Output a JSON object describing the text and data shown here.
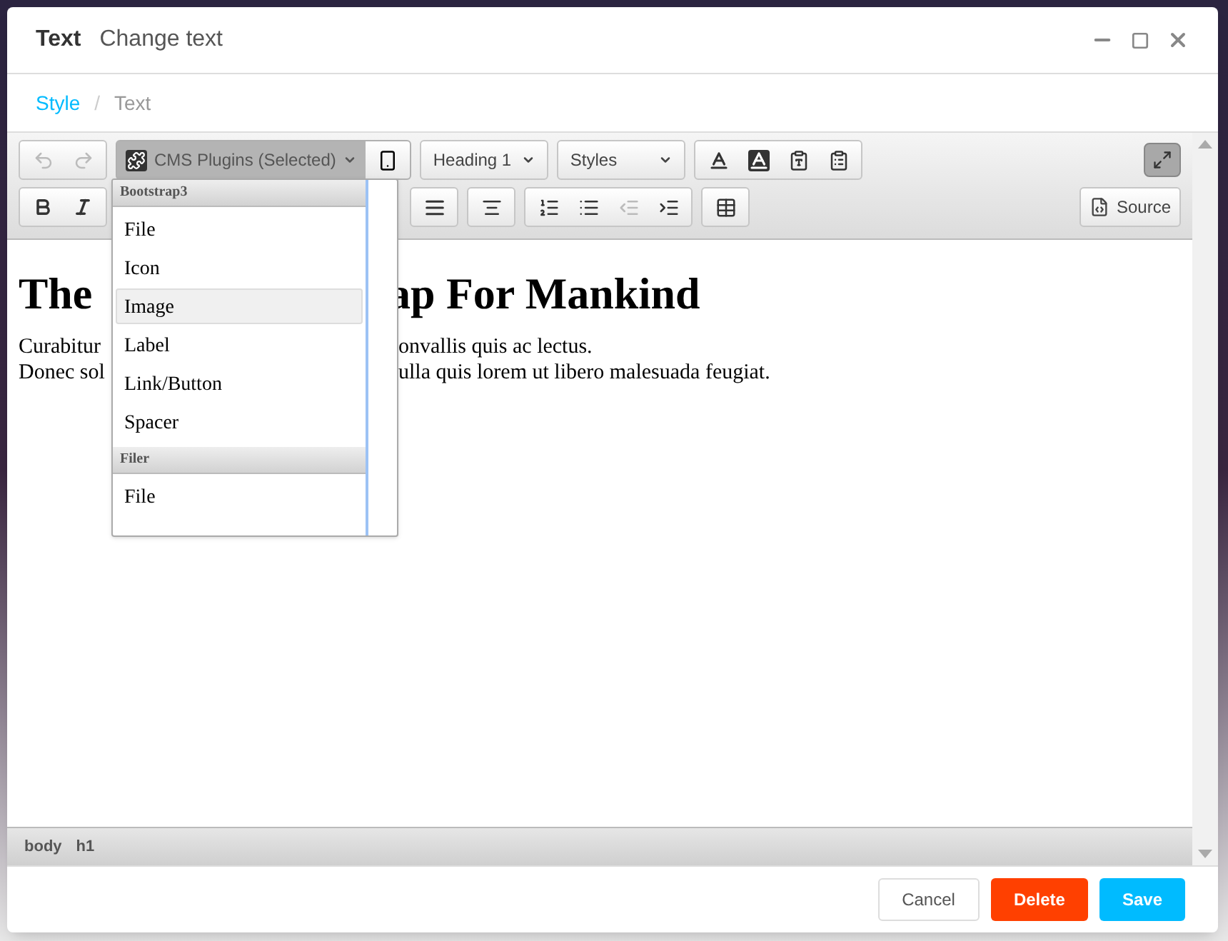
{
  "window": {
    "title": "Text",
    "subtitle": "Change text"
  },
  "breadcrumb": {
    "separator": "/",
    "items": [
      {
        "label": "Style",
        "link": true
      },
      {
        "label": "Text",
        "link": false
      }
    ]
  },
  "toolbar": {
    "plugins_combo": {
      "label": "CMS Plugins (Selected)",
      "open": true
    },
    "format_combo": "Heading 1",
    "styles_combo": "Styles",
    "source_button": "Source",
    "maximize_pressed": true,
    "history": [
      {
        "kind": "undo",
        "disabled": true
      },
      {
        "kind": "redo",
        "disabled": true
      }
    ],
    "lists": [
      {
        "kind": "numbered",
        "disabled": false
      },
      {
        "kind": "bulleted",
        "disabled": false
      },
      {
        "kind": "outdent",
        "disabled": true
      },
      {
        "kind": "indent",
        "disabled": false
      }
    ]
  },
  "dropdown": {
    "groups": [
      {
        "title": "Bootstrap3",
        "items": [
          {
            "label": "File",
            "selected": false
          },
          {
            "label": "Icon",
            "selected": false
          },
          {
            "label": "Image",
            "selected": true
          },
          {
            "label": "Label",
            "selected": false
          },
          {
            "label": "Link/Button",
            "selected": false
          },
          {
            "label": "Spacer",
            "selected": false
          }
        ]
      },
      {
        "title": "Filer",
        "items": [
          {
            "label": "File",
            "selected": false
          }
        ]
      }
    ]
  },
  "content": {
    "heading": [
      "The",
      "ap For Mankind"
    ],
    "paragraphs": [
      [
        "Curabitur",
        "onvallis quis ac lectus."
      ],
      [
        "Donec sol",
        "ulla quis lorem ut libero malesuada feugiat."
      ]
    ]
  },
  "element_path": [
    "body",
    "h1"
  ],
  "buttons": [
    {
      "label": "Cancel",
      "kind": "default"
    },
    {
      "label": "Delete",
      "kind": "danger"
    },
    {
      "label": "Save",
      "kind": "primary"
    }
  ]
}
